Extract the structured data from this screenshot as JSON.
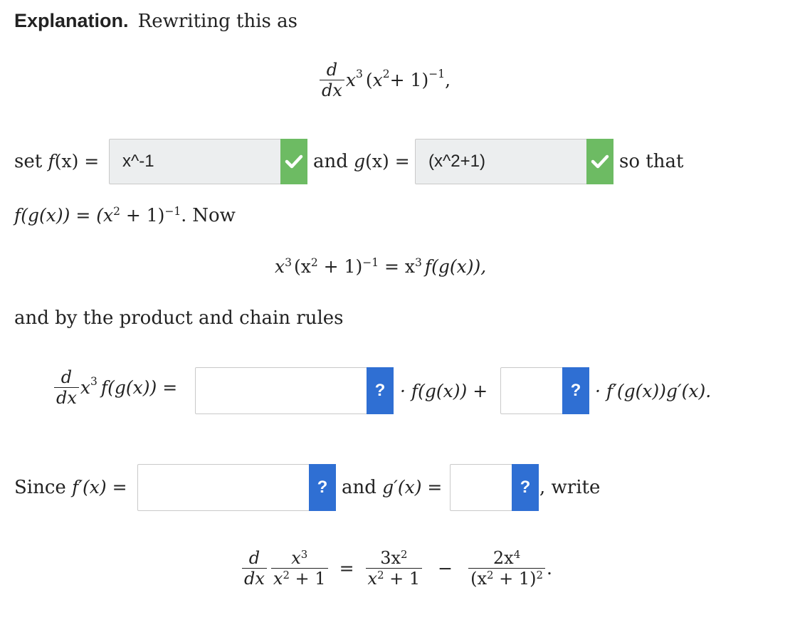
{
  "heading": "Explanation.",
  "intro_text": "Rewriting this as",
  "eq1": {
    "num": "d",
    "den": "dx",
    "body_x": "x",
    "body_e1": "3",
    "body_open": "(",
    "body_x2": "x",
    "body_e2": "2",
    "body_rest": " + 1)",
    "body_e3": "−1",
    "tail": ","
  },
  "row_set": {
    "set_word": "set ",
    "f_label": "f",
    "f_arg": "(x) =",
    "f_value": "x^-1",
    "and_word": "and ",
    "g_label": "g",
    "g_arg": "(x) =",
    "g_value": "(x^2+1)",
    "so_that": "so that"
  },
  "line_fg": {
    "lhs": "f(g(x)) = (x",
    "e2": "2",
    "mid": " + 1)",
    "em1": "−1",
    "dot": ". ",
    "now": "Now"
  },
  "eq2": {
    "x": "x",
    "e3": "3",
    "open": "(x",
    "e2": "2",
    "mid": " + 1)",
    "em1": "−1",
    "rhs": " = x",
    "e3b": "3",
    "rhs2": "f(g(x)),",
    "tail": ""
  },
  "chain_text": "and by the product and chain rules",
  "eq3": {
    "num": "d",
    "den": "dx",
    "x": "x",
    "e3": "3",
    "fg": "f(g(x)) =",
    "mid": "· f(g(x)) +",
    "tail": "· f′(g(x))g′(x)."
  },
  "row_since": {
    "since": "Since ",
    "fprime": "f′(x) =",
    "and_word": "and ",
    "gprime": "g′(x) =",
    "write": ", write"
  },
  "eq4": {
    "d_num": "d",
    "d_den": "dx",
    "f1_num_x": "x",
    "f1_num_e": "3",
    "f1_den_x": "x",
    "f1_den_e": "2",
    "f1_den_rest": " + 1",
    "eq": "=",
    "f2_num": "3x",
    "f2_num_e": "2",
    "f2_den_x": "x",
    "f2_den_e": "2",
    "f2_den_rest": " + 1",
    "minus": "−",
    "f3_num": "2x",
    "f3_num_e": "4",
    "f3_den": "(x",
    "f3_den_e": "2",
    "f3_den_rest": " + 1)",
    "f3_den_e2": "2",
    "end": "."
  },
  "help_label": "?",
  "colors": {
    "check": "#6dbb63",
    "help": "#2f6fd3",
    "filled_input": "#eceeef"
  },
  "icons": {
    "check": "check-icon",
    "help": "question-mark"
  }
}
